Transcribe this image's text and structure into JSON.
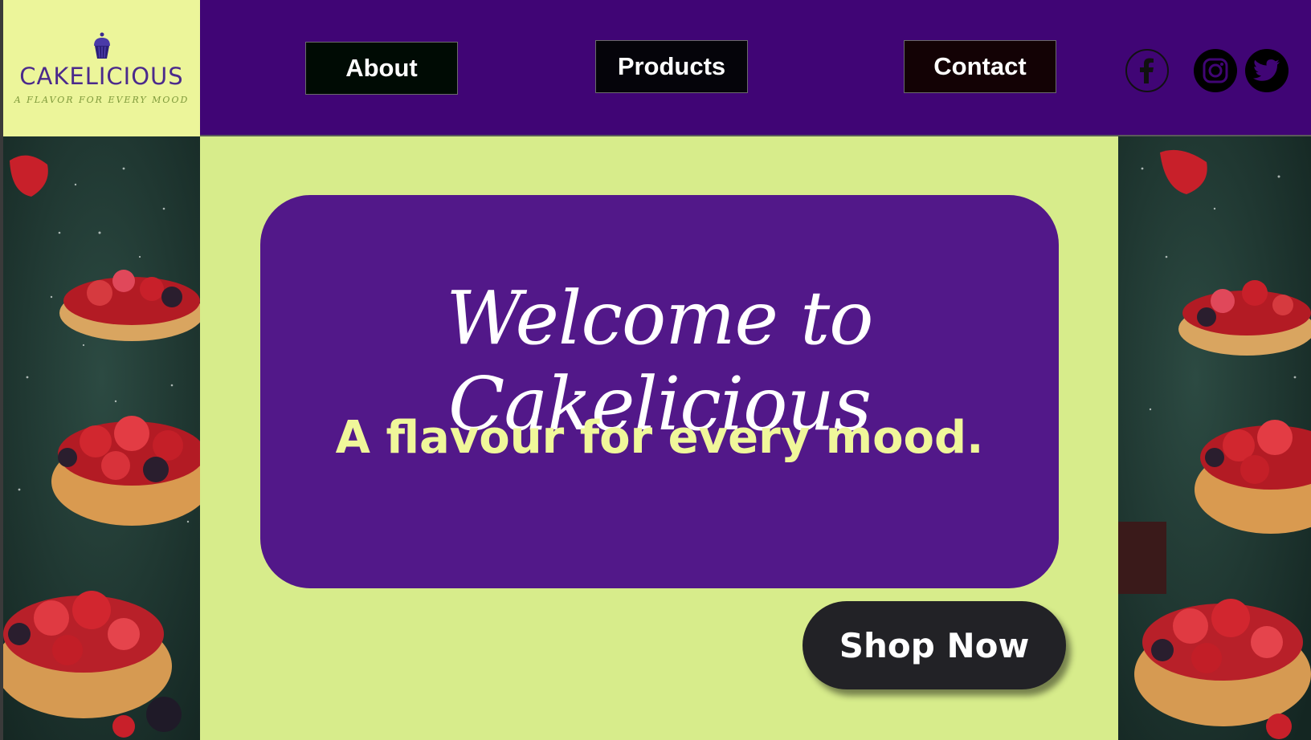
{
  "brand": {
    "name": "CAKELICIOUS",
    "tagline": "A FLAVOR FOR EVERY MOOD",
    "logo_icon": "cupcake-icon"
  },
  "nav": {
    "items": [
      {
        "label": "About"
      },
      {
        "label": "Products"
      },
      {
        "label": "Contact"
      }
    ]
  },
  "social": {
    "icons": [
      "facebook-icon",
      "instagram-icon",
      "twitter-icon"
    ]
  },
  "hero": {
    "title": "Welcome to Cakelicious",
    "subtitle": "A flavour for every mood."
  },
  "cta": {
    "label": "Shop Now"
  },
  "colors": {
    "header_bg": "#400575",
    "page_bg": "#d7ec8b",
    "hero_bg": "#521889",
    "subtitle": "#f0f79a",
    "logo_bg": "#ecf59a",
    "button_bg": "#222226"
  }
}
